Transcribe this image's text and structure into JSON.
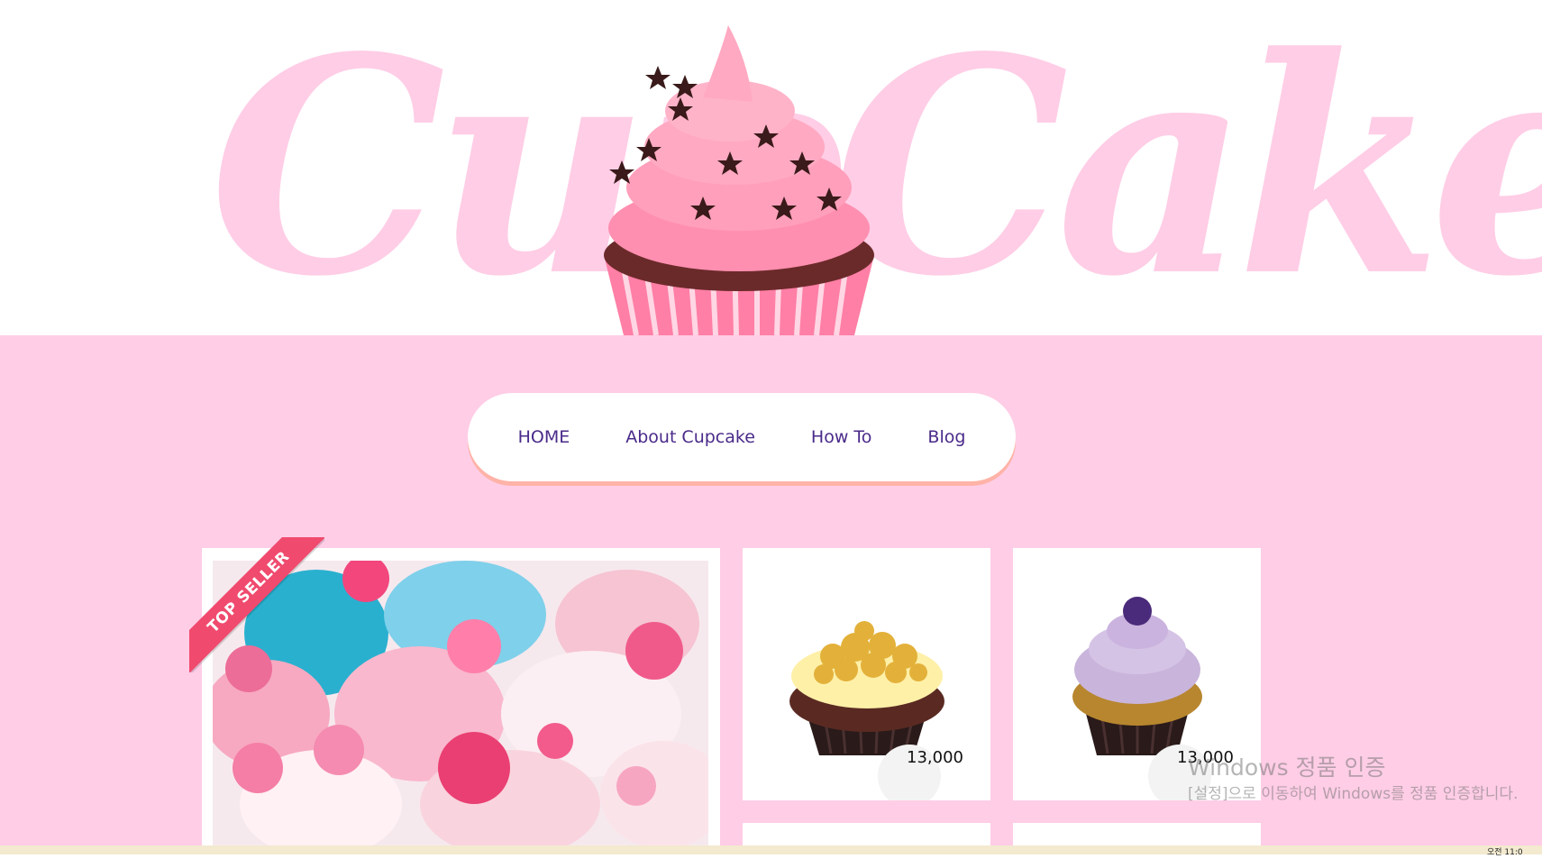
{
  "header": {
    "logo_text": "CupCake"
  },
  "nav": {
    "items": [
      {
        "label": "HOME"
      },
      {
        "label": "About Cupcake"
      },
      {
        "label": "How To"
      },
      {
        "label": "Blog"
      }
    ]
  },
  "featured": {
    "badge": "TOP SELLER"
  },
  "products": [
    {
      "price": "13,000"
    },
    {
      "price": "13,000"
    }
  ],
  "watermark": {
    "title": "Windows 정품 인증",
    "subtitle": "[설정]으로 이동하여 Windows를 정품 인증합니다."
  },
  "taskbar": {
    "clock": "오전 11:0"
  },
  "colors": {
    "brand_pink": "#ffcde6",
    "nav_text": "#4a2a8a",
    "ribbon": "#f04a6e",
    "nav_shadow": "#ffb3a8"
  }
}
